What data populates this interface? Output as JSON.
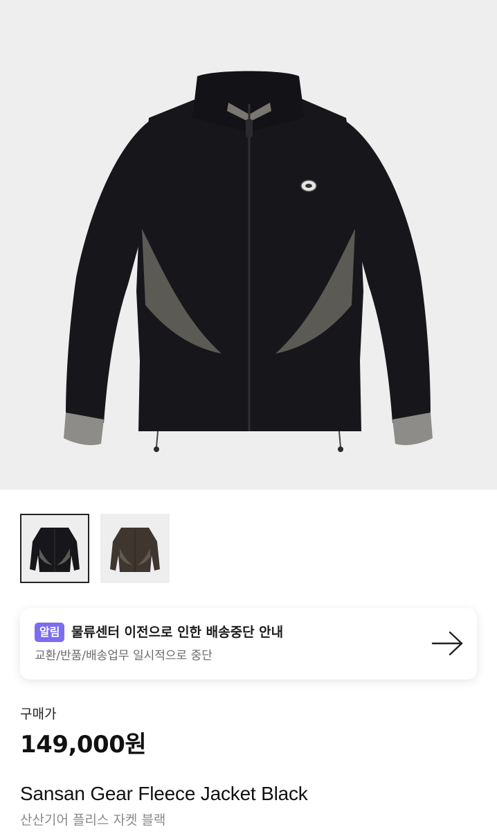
{
  "product": {
    "main_image": "product-photo-black-fleece-jacket",
    "thumbnails": [
      {
        "image": "black-fleece-jacket-thumbnail",
        "selected": true
      },
      {
        "image": "brown-fleece-jacket-thumbnail",
        "selected": false
      }
    ],
    "price_label": "구매가",
    "price": "149,000원",
    "name_en": "Sansan Gear Fleece Jacket Black",
    "name_ko": "산산기어 플리스 자켓 블랙"
  },
  "notice": {
    "badge": "알림",
    "title": "물류센터 이전으로 인한 배송중단 안내",
    "subtitle": "교환/반품/배송업무 일시적으로 중단",
    "icon": "arrow-right-icon"
  },
  "colors": {
    "badge_bg": "#7b6cf0",
    "image_bg": "#eeeeef",
    "jacket_black": "#16161b",
    "panel_grey": "#5c5a54",
    "thumb_brown": "#3f3630"
  }
}
